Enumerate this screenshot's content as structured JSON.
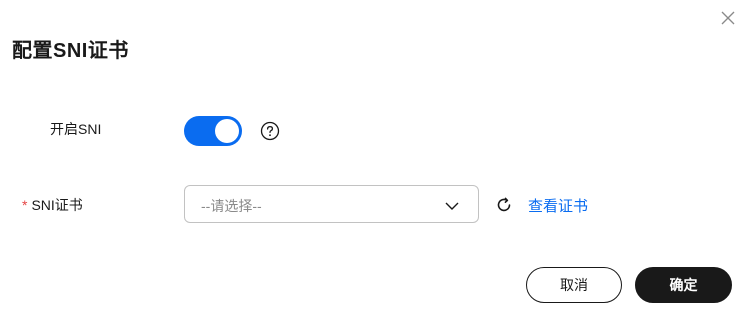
{
  "dialog": {
    "title": "配置SNI证书",
    "close_icon": "close-icon"
  },
  "form": {
    "enable_sni": {
      "label": "开启SNI",
      "toggle_on": true,
      "help_icon": "question-circle-icon"
    },
    "sni_cert": {
      "required_mark": "*",
      "label": "SNI证书",
      "placeholder": "--请选择--",
      "refresh_icon": "refresh-icon",
      "view_link": "查看证书"
    }
  },
  "footer": {
    "cancel_label": "取消",
    "confirm_label": "确定"
  },
  "colors": {
    "accent": "#0a6cf0",
    "required": "#e54545",
    "primary_button": "#191919"
  }
}
